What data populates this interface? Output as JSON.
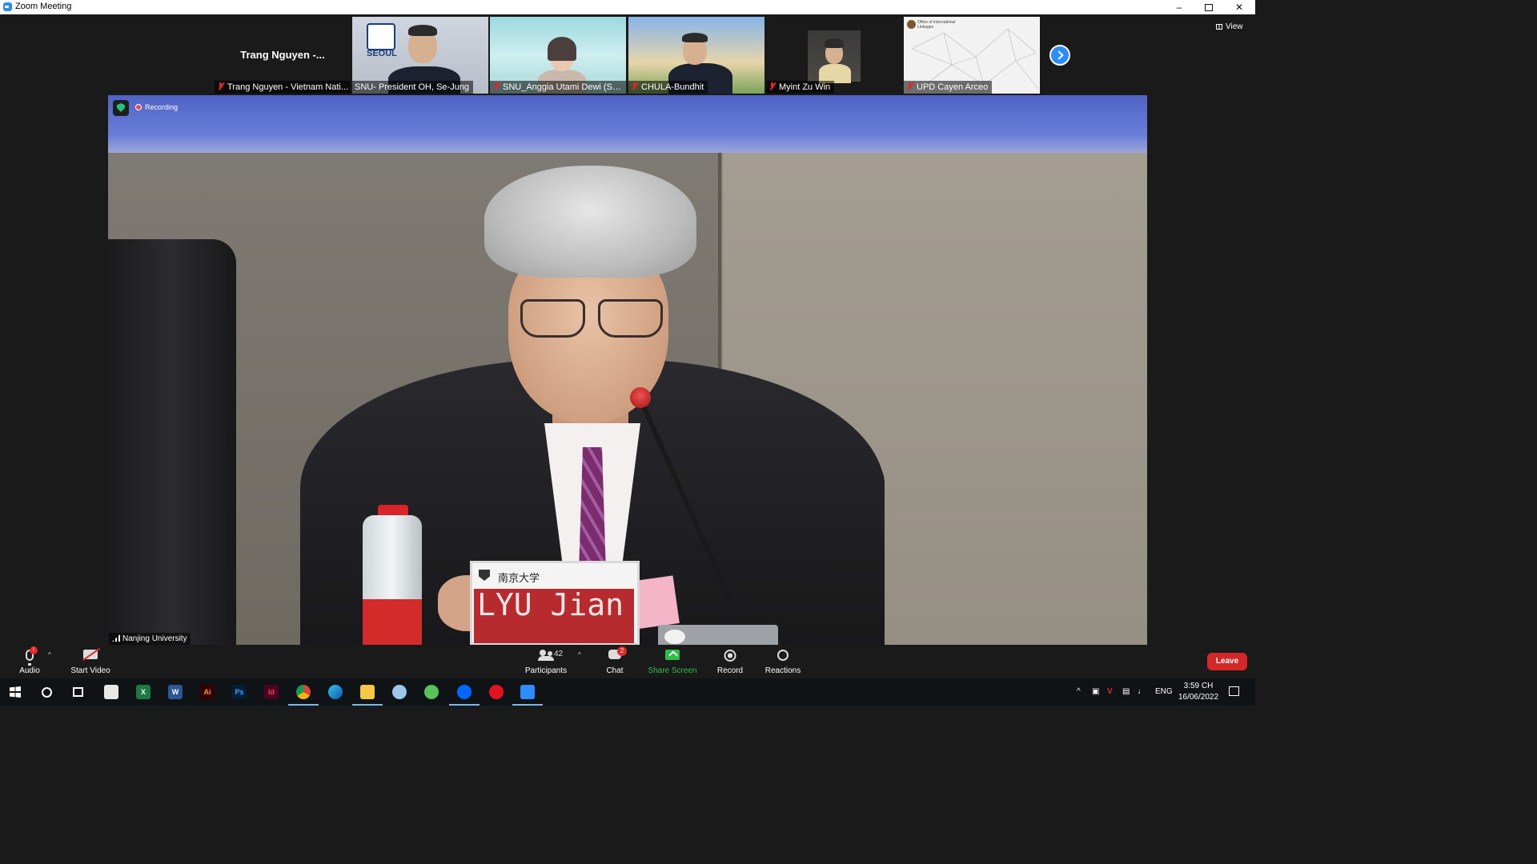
{
  "window": {
    "title": "Zoom Meeting"
  },
  "gallery": {
    "tiles": [
      {
        "big_name": "Trang Nguyen -...",
        "label": "Trang Nguyen - Vietnam Nati..."
      },
      {
        "label": "SNU- President OH, Se-Jung",
        "logo_text": "SEOUL"
      },
      {
        "label": "SNU_Anggia Utami Dewi (SPF)"
      },
      {
        "label": "CHULA-Bundhit"
      },
      {
        "label": "Myint Zu Win"
      },
      {
        "label": "UPD Cayen Arceo",
        "logo_text": "Office of International Linkages"
      }
    ],
    "view_label": "View"
  },
  "main_video": {
    "recording_label": "Recording",
    "speaker_label": "Nanjing University",
    "nameplate_cn": "南京大学",
    "nameplate_name": "LYU Jian"
  },
  "toolbar": {
    "audio_label": "Audio",
    "video_label": "Start Video",
    "participants_label": "Participants",
    "participants_count": "42",
    "chat_label": "Chat",
    "chat_badge": "2",
    "share_label": "Share Screen",
    "record_label": "Record",
    "reactions_label": "Reactions",
    "leave_label": "Leave"
  },
  "taskbar": {
    "apps": [
      "Ai",
      "Ps",
      "Id"
    ],
    "language": "ENG",
    "time": "3:59 CH",
    "date": "16/06/2022"
  },
  "colors": {
    "zoom_blue": "#2d8cff",
    "leave_red": "#d42828",
    "share_green": "#2bbf4a"
  }
}
